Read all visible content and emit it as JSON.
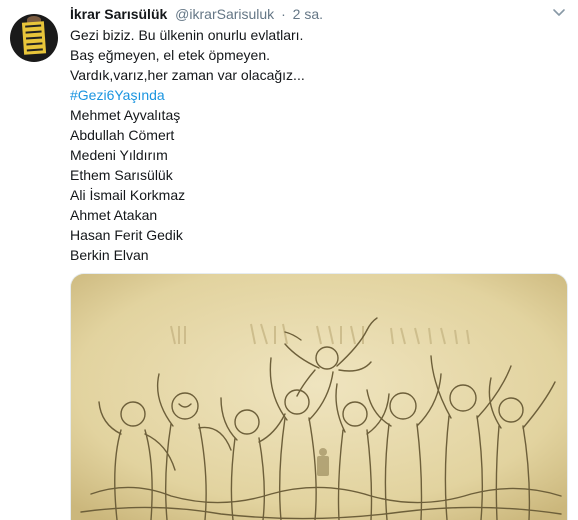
{
  "tweet": {
    "author_name": "İkrar Sarısülük",
    "author_handle": "@ikrarSarisuluk",
    "separator": "·",
    "time": "2 sa.",
    "lines": [
      "Gezi biziz. Bu ülkenin onurlu evlatları.",
      "Baş eğmeyen, el etek öpmeyen.",
      "Vardık,varız,her zaman var olacağız..."
    ],
    "hashtag": "#Gezi6Yaşında",
    "names": [
      "Mehmet Ayvalıtaş",
      "Abdullah Cömert",
      "Medeni Yıldırım",
      "Ethem Sarısülük",
      "Ali İsmail Korkmaz",
      "Ahmet Atakan",
      "Hasan Ferit Gedik",
      "Berkin Elvan"
    ]
  },
  "icons": {
    "caret": "chevron-down-icon"
  },
  "colors": {
    "link": "#1b95e0",
    "muted": "#657786",
    "media_background": "#e7d9a9"
  }
}
